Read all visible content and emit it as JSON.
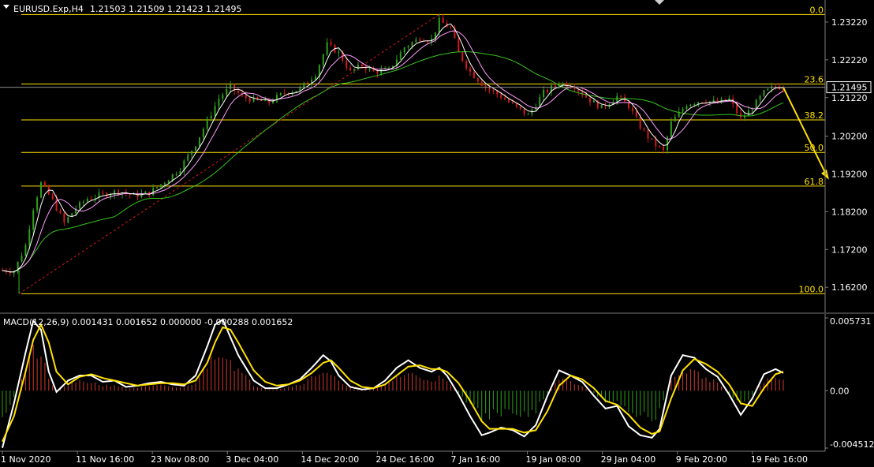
{
  "header": {
    "symbol": "EURUSD.Exp,H4",
    "ohlc": "1.21503 1.21509 1.21423 1.21495"
  },
  "current_price": "1.21495",
  "macd_header": "MACD(12,26,9) 0.001431 0.001652 0.000000 -0.000288 0.001652",
  "colors": {
    "background": "#000000",
    "bull_candle": "#2ea11b",
    "bear_candle": "#d11a1a",
    "fib": "#ffe100",
    "arrow": "#ffe100",
    "trend": "#d11a1a",
    "ma_fast": "#ffffff",
    "ma_mid": "#ff9cff",
    "ma_slow": "#35c41a",
    "macd_pos": "#cf3a2a",
    "macd_neg": "#2ea11b",
    "macd_main": "#ffffff",
    "macd_signal": "#ffe100"
  },
  "chart_data": [
    {
      "type": "candlestick",
      "ylim": [
        1.1562,
        1.2372
      ],
      "y_ticks": [
        "1.23220",
        "1.22220",
        "1.21220",
        "1.20200",
        "1.19200",
        "1.18200",
        "1.17200",
        "1.16200"
      ],
      "y_tick_values": [
        1.2322,
        1.2222,
        1.2122,
        1.202,
        1.192,
        1.182,
        1.172,
        1.162
      ],
      "x_ticks": [
        "1 Nov 2020",
        "11 Nov 16:00",
        "23 Nov 08:00",
        "3 Dec 04:00",
        "14 Dec 20:00",
        "24 Dec 16:00",
        "7 Jan 16:00",
        "19 Jan 08:00",
        "29 Jan 04:00",
        "9 Feb 20:00",
        "19 Feb 16:00"
      ],
      "fib_levels": [
        {
          "label": "0.0",
          "price": 1.2342
        },
        {
          "label": "23.6",
          "price": 1.2158
        },
        {
          "label": "38.2",
          "price": 1.2063
        },
        {
          "label": "50.0",
          "price": 1.1977
        },
        {
          "label": "61.8",
          "price": 1.1888
        },
        {
          "label": "100.0",
          "price": 1.1603
        }
      ],
      "close_path": [
        [
          0,
          1.1665
        ],
        [
          3,
          1.1663
        ],
        [
          6,
          1.173
        ],
        [
          8,
          1.183
        ],
        [
          10,
          1.1895
        ],
        [
          13,
          1.185
        ],
        [
          16,
          1.179
        ],
        [
          19,
          1.183
        ],
        [
          22,
          1.1855
        ],
        [
          26,
          1.1865
        ],
        [
          30,
          1.1875
        ],
        [
          34,
          1.1862
        ],
        [
          38,
          1.187
        ],
        [
          42,
          1.19
        ],
        [
          46,
          1.1935
        ],
        [
          50,
          1.2
        ],
        [
          53,
          1.206
        ],
        [
          56,
          1.212
        ],
        [
          59,
          1.215
        ],
        [
          62,
          1.2125
        ],
        [
          65,
          1.2115
        ],
        [
          69,
          1.211
        ],
        [
          73,
          1.2135
        ],
        [
          77,
          1.2145
        ],
        [
          81,
          1.2185
        ],
        [
          84,
          1.2262
        ],
        [
          87,
          1.224
        ],
        [
          90,
          1.219
        ],
        [
          93,
          1.2208
        ],
        [
          96,
          1.219
        ],
        [
          100,
          1.2195
        ],
        [
          104,
          1.2255
        ],
        [
          108,
          1.228
        ],
        [
          111,
          1.2275
        ],
        [
          113,
          1.2325
        ],
        [
          116,
          1.2305
        ],
        [
          118,
          1.224
        ],
        [
          121,
          1.219
        ],
        [
          125,
          1.215
        ],
        [
          129,
          1.2125
        ],
        [
          133,
          1.2095
        ],
        [
          136,
          1.2075
        ],
        [
          140,
          1.2135
        ],
        [
          144,
          1.216
        ],
        [
          148,
          1.2152
        ],
        [
          152,
          1.2115
        ],
        [
          155,
          1.2095
        ],
        [
          159,
          1.2125
        ],
        [
          162,
          1.21
        ],
        [
          165,
          1.2045
        ],
        [
          168,
          1.2005
        ],
        [
          171,
          1.198
        ],
        [
          173,
          1.2055
        ],
        [
          177,
          1.2105
        ],
        [
          181,
          1.2115
        ],
        [
          185,
          1.2108
        ],
        [
          188,
          1.2118
        ],
        [
          191,
          1.2065
        ],
        [
          194,
          1.2095
        ],
        [
          197,
          1.2135
        ],
        [
          200,
          1.2152
        ],
        [
          202,
          1.2149
        ]
      ]
    },
    {
      "type": "macd",
      "params": "12,26,9",
      "ylim": [
        -0.004512,
        0.005731
      ],
      "y_ticks": [
        "0.005731",
        "0.00",
        "-0.004512"
      ],
      "main_path": [
        [
          0,
          -0.0045
        ],
        [
          3,
          -0.001
        ],
        [
          6,
          0.003
        ],
        [
          8,
          0.0055
        ],
        [
          10,
          0.0048
        ],
        [
          12,
          0.0015
        ],
        [
          14,
          -0.0001
        ],
        [
          17,
          0.0008
        ],
        [
          20,
          0.0012
        ],
        [
          23,
          0.0012
        ],
        [
          26,
          0.0007
        ],
        [
          29,
          0.0008
        ],
        [
          32,
          0.0003
        ],
        [
          35,
          0.0004
        ],
        [
          38,
          0.0006
        ],
        [
          41,
          0.0007
        ],
        [
          44,
          0.0005
        ],
        [
          47,
          0.0004
        ],
        [
          50,
          0.0012
        ],
        [
          53,
          0.0035
        ],
        [
          55,
          0.0052
        ],
        [
          57,
          0.0056
        ],
        [
          59,
          0.0042
        ],
        [
          61,
          0.0028
        ],
        [
          63,
          0.0018
        ],
        [
          65,
          0.0008
        ],
        [
          68,
          0.0002
        ],
        [
          71,
          0.0002
        ],
        [
          74,
          0.0005
        ],
        [
          77,
          0.0009
        ],
        [
          80,
          0.0018
        ],
        [
          83,
          0.0028
        ],
        [
          85,
          0.0023
        ],
        [
          87,
          0.0012
        ],
        [
          90,
          0.0003
        ],
        [
          93,
          0.0001
        ],
        [
          96,
          0.0002
        ],
        [
          99,
          0.0008
        ],
        [
          102,
          0.0018
        ],
        [
          105,
          0.0024
        ],
        [
          108,
          0.0018
        ],
        [
          111,
          0.0015
        ],
        [
          113,
          0.0018
        ],
        [
          115,
          0.0012
        ],
        [
          118,
          -0.0003
        ],
        [
          121,
          -0.002
        ],
        [
          124,
          -0.0035
        ],
        [
          126,
          -0.0033
        ],
        [
          129,
          -0.0029
        ],
        [
          132,
          -0.0031
        ],
        [
          135,
          -0.0036
        ],
        [
          138,
          -0.0027
        ],
        [
          141,
          -0.0004
        ],
        [
          144,
          0.0016
        ],
        [
          147,
          0.0012
        ],
        [
          150,
          0.0007
        ],
        [
          153,
          -0.0004
        ],
        [
          156,
          -0.0014
        ],
        [
          159,
          -0.0012
        ],
        [
          162,
          -0.0028
        ],
        [
          165,
          -0.0035
        ],
        [
          168,
          -0.0037
        ],
        [
          170,
          -0.003
        ],
        [
          173,
          0.0012
        ],
        [
          176,
          0.0028
        ],
        [
          179,
          0.0026
        ],
        [
          182,
          0.0017
        ],
        [
          185,
          0.0011
        ],
        [
          188,
          -0.0003
        ],
        [
          191,
          -0.0019
        ],
        [
          194,
          -0.0006
        ],
        [
          197,
          0.0013
        ],
        [
          200,
          0.0017
        ],
        [
          202,
          0.0014
        ]
      ],
      "signal_path": [
        [
          0,
          -0.004
        ],
        [
          3,
          -0.002
        ],
        [
          6,
          0.0015
        ],
        [
          8,
          0.004
        ],
        [
          10,
          0.0052
        ],
        [
          12,
          0.0038
        ],
        [
          14,
          0.0015
        ],
        [
          17,
          0.0005
        ],
        [
          20,
          0.0011
        ],
        [
          23,
          0.0013
        ],
        [
          26,
          0.001
        ],
        [
          29,
          0.0008
        ],
        [
          32,
          0.0006
        ],
        [
          35,
          0.0004
        ],
        [
          38,
          0.0005
        ],
        [
          41,
          0.0006
        ],
        [
          44,
          0.0006
        ],
        [
          47,
          0.0005
        ],
        [
          50,
          0.0008
        ],
        [
          53,
          0.0022
        ],
        [
          55,
          0.0038
        ],
        [
          57,
          0.005
        ],
        [
          59,
          0.0048
        ],
        [
          61,
          0.0038
        ],
        [
          63,
          0.0027
        ],
        [
          65,
          0.0016
        ],
        [
          68,
          0.0007
        ],
        [
          71,
          0.0004
        ],
        [
          74,
          0.0005
        ],
        [
          77,
          0.0008
        ],
        [
          80,
          0.0014
        ],
        [
          83,
          0.0022
        ],
        [
          85,
          0.0024
        ],
        [
          87,
          0.0018
        ],
        [
          90,
          0.0008
        ],
        [
          93,
          0.0003
        ],
        [
          96,
          0.0002
        ],
        [
          99,
          0.0005
        ],
        [
          102,
          0.0012
        ],
        [
          105,
          0.0019
        ],
        [
          108,
          0.002
        ],
        [
          111,
          0.0017
        ],
        [
          113,
          0.0017
        ],
        [
          115,
          0.0015
        ],
        [
          118,
          0.0006
        ],
        [
          121,
          -0.0008
        ],
        [
          124,
          -0.0024
        ],
        [
          126,
          -0.003
        ],
        [
          129,
          -0.003
        ],
        [
          132,
          -0.003
        ],
        [
          135,
          -0.0033
        ],
        [
          138,
          -0.0031
        ],
        [
          141,
          -0.0016
        ],
        [
          144,
          0.0004
        ],
        [
          147,
          0.0012
        ],
        [
          150,
          0.0009
        ],
        [
          153,
          0.0002
        ],
        [
          156,
          -0.0008
        ],
        [
          159,
          -0.0011
        ],
        [
          162,
          -0.0019
        ],
        [
          165,
          -0.0029
        ],
        [
          168,
          -0.0034
        ],
        [
          170,
          -0.0032
        ],
        [
          173,
          -0.0006
        ],
        [
          176,
          0.0016
        ],
        [
          179,
          0.0025
        ],
        [
          182,
          0.0021
        ],
        [
          185,
          0.0015
        ],
        [
          188,
          0.0005
        ],
        [
          191,
          -0.001
        ],
        [
          194,
          -0.0012
        ],
        [
          197,
          0.0002
        ],
        [
          200,
          0.0013
        ],
        [
          202,
          0.0015
        ]
      ]
    }
  ]
}
